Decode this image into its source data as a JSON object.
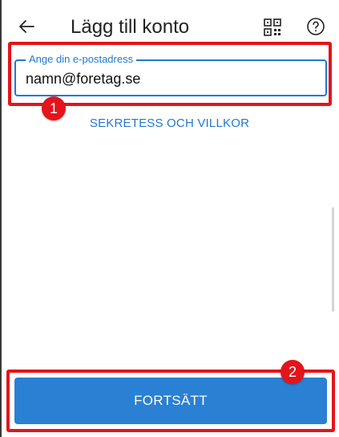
{
  "header": {
    "title": "Lägg till konto",
    "back_icon": "arrow-left-icon",
    "qr_icon": "qr-code-icon",
    "help_icon": "help-circle-icon"
  },
  "email": {
    "label": "Ange din e-postadress",
    "value": "namn@foretag.se"
  },
  "privacy_link": "SEKRETESS OCH VILLKOR",
  "continue_button": "FORTSÄTT",
  "annotations": {
    "step1": "1",
    "step2": "2"
  },
  "colors": {
    "accent": "#1f78d1",
    "button": "#2a80d2",
    "annotation": "#e4141b"
  }
}
